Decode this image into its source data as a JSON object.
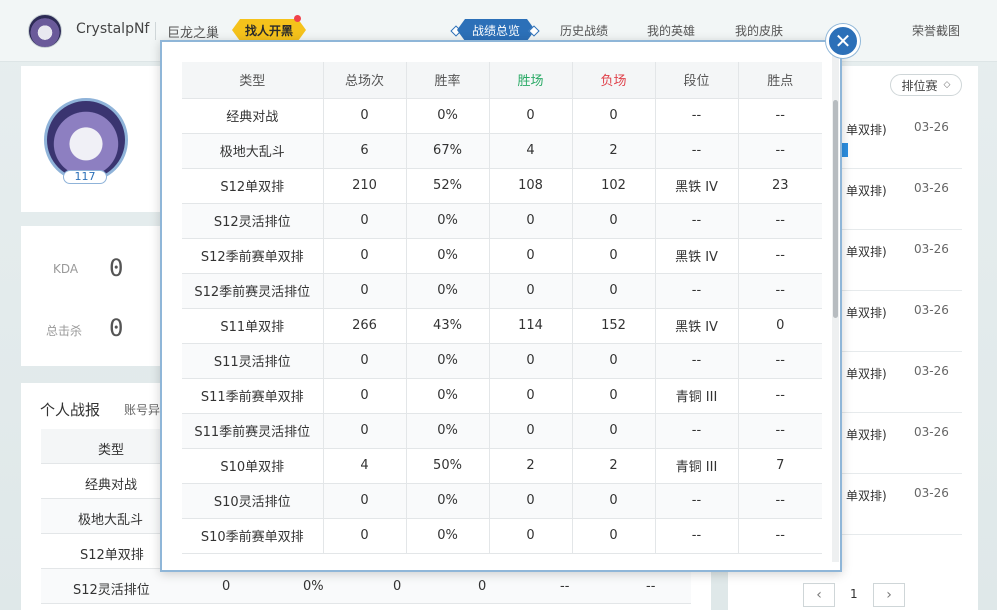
{
  "user": {
    "name": "CrystalpNf",
    "level": "117"
  },
  "topnav": {
    "julong": "巨龙之巢",
    "zhaoren": "找人开黑",
    "items": [
      "战绩总览",
      "历史战绩",
      "我的英雄",
      "我的皮肤",
      "荣誉截图"
    ]
  },
  "background": {
    "kda_label": "KDA",
    "kda_value": "0",
    "kills_label": "总击杀",
    "kills_value": "0",
    "report_title": "个人战报",
    "report_sub": "账号异",
    "table_header": "类型",
    "rows": [
      {
        "type": "经典对战"
      },
      {
        "type": "极地大乱斗"
      },
      {
        "type": "S12单双排"
      },
      {
        "type": "S12灵活排位",
        "total": "0",
        "rate": "0%",
        "win": "0",
        "lose": "0",
        "rank": "--",
        "lp": "--"
      }
    ],
    "rank_select": "排位赛",
    "right_list": [
      {
        "label": "单双排)",
        "date": "03-26"
      },
      {
        "label": "单双排)",
        "date": "03-26"
      },
      {
        "label": "单双排)",
        "date": "03-26"
      },
      {
        "label": "单双排)",
        "date": "03-26"
      },
      {
        "label": "单双排)",
        "date": "03-26"
      },
      {
        "label": "单双排)",
        "date": "03-26"
      },
      {
        "label": "单双排)",
        "date": "03-26"
      }
    ],
    "page": "1"
  },
  "modal": {
    "headers": [
      "类型",
      "总场次",
      "胜率",
      "胜场",
      "负场",
      "段位",
      "胜点"
    ],
    "rows": [
      [
        "经典对战",
        "0",
        "0%",
        "0",
        "0",
        "--",
        "--"
      ],
      [
        "极地大乱斗",
        "6",
        "67%",
        "4",
        "2",
        "--",
        "--"
      ],
      [
        "S12单双排",
        "210",
        "52%",
        "108",
        "102",
        "黑铁 IV",
        "23"
      ],
      [
        "S12灵活排位",
        "0",
        "0%",
        "0",
        "0",
        "--",
        "--"
      ],
      [
        "S12季前赛单双排",
        "0",
        "0%",
        "0",
        "0",
        "黑铁 IV",
        "--"
      ],
      [
        "S12季前赛灵活排位",
        "0",
        "0%",
        "0",
        "0",
        "--",
        "--"
      ],
      [
        "S11单双排",
        "266",
        "43%",
        "114",
        "152",
        "黑铁 IV",
        "0"
      ],
      [
        "S11灵活排位",
        "0",
        "0%",
        "0",
        "0",
        "--",
        "--"
      ],
      [
        "S11季前赛单双排",
        "0",
        "0%",
        "0",
        "0",
        "青铜 III",
        "--"
      ],
      [
        "S11季前赛灵活排位",
        "0",
        "0%",
        "0",
        "0",
        "--",
        "--"
      ],
      [
        "S10单双排",
        "4",
        "50%",
        "2",
        "2",
        "青铜 III",
        "7"
      ],
      [
        "S10灵活排位",
        "0",
        "0%",
        "0",
        "0",
        "--",
        "--"
      ],
      [
        "S10季前赛单双排",
        "0",
        "0%",
        "0",
        "0",
        "--",
        "--"
      ]
    ],
    "close_glyph": "✕"
  },
  "colors": {
    "accent": "#2c70b8",
    "win": "#2aaa66",
    "lose": "#e0424b",
    "highlight": "#f5c21b"
  }
}
